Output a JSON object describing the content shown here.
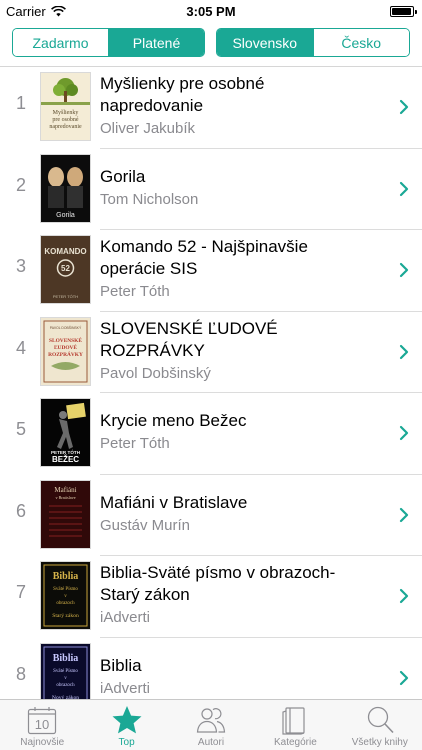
{
  "status_bar": {
    "carrier": "Carrier",
    "time": "3:05 PM",
    "battery_level": 0.95
  },
  "segments": {
    "price": [
      {
        "label": "Zadarmo",
        "active": false
      },
      {
        "label": "Platené",
        "active": true
      }
    ],
    "language": [
      {
        "label": "Slovensko",
        "active": true
      },
      {
        "label": "Česko",
        "active": false
      }
    ]
  },
  "books": [
    {
      "rank": "1",
      "title_lines": [
        "Myšlienky pre osobné",
        "napredovanie"
      ],
      "author": "Oliver Jakubík",
      "cover_text": [
        "Myšlienky",
        "pre osobné",
        "napredovanie"
      ]
    },
    {
      "rank": "2",
      "title_lines": [
        "Gorila"
      ],
      "author": "Tom Nicholson",
      "cover_text": [
        "Gorila"
      ]
    },
    {
      "rank": "3",
      "title_lines": [
        "Komando 52 - Najšpinavšie",
        "operácie SIS"
      ],
      "author": "Peter Tóth",
      "cover_text": [
        "KOMANDO",
        "52",
        "PETER TÓTH"
      ]
    },
    {
      "rank": "4",
      "title_lines": [
        "SLOVENSKÉ ĽUDOVÉ",
        "ROZPRÁVKY"
      ],
      "author": "Pavol Dobšinský",
      "cover_text": [
        "PAVOL DOBŠINSKÝ",
        "SLOVENSKÉ",
        "ĽUDOVÉ",
        "ROZPRÁVKY"
      ]
    },
    {
      "rank": "5",
      "title_lines": [
        "Krycie meno Bežec"
      ],
      "author": "Peter Tóth",
      "cover_text": [
        "PETER TÓTH",
        "BEŽEC"
      ]
    },
    {
      "rank": "6",
      "title_lines": [
        "Mafiáni v Bratislave"
      ],
      "author": "Gustáv Murín",
      "cover_text": [
        "Mafiáni",
        "v Bratislave"
      ]
    },
    {
      "rank": "7",
      "title_lines": [
        "Biblia-Sväté písmo v obrazoch-",
        "Starý zákon"
      ],
      "author": "iAdverti",
      "cover_text": [
        "Biblia",
        "Sväté Písmo",
        "v",
        "obrazoch",
        "Starý zákon"
      ]
    },
    {
      "rank": "8",
      "title_lines": [
        "Biblia"
      ],
      "author": "iAdverti",
      "cover_text": [
        "Biblia",
        "Sväté Písmo",
        "v",
        "obrazoch",
        "Nový zákon"
      ]
    }
  ],
  "tab_bar": {
    "calendar_day": "10",
    "tabs": [
      {
        "label": "Najnovšie",
        "icon": "calendar-icon",
        "active": false
      },
      {
        "label": "Top",
        "icon": "star-icon",
        "active": true
      },
      {
        "label": "Autori",
        "icon": "people-icon",
        "active": false
      },
      {
        "label": "Kategórie",
        "icon": "books-icon",
        "active": false
      },
      {
        "label": "Všetky knihy",
        "icon": "search-icon",
        "active": false
      }
    ]
  },
  "colors": {
    "accent": "#1aa895",
    "secondary_text": "#8a8a8f",
    "rank_text": "#8e8e93"
  }
}
